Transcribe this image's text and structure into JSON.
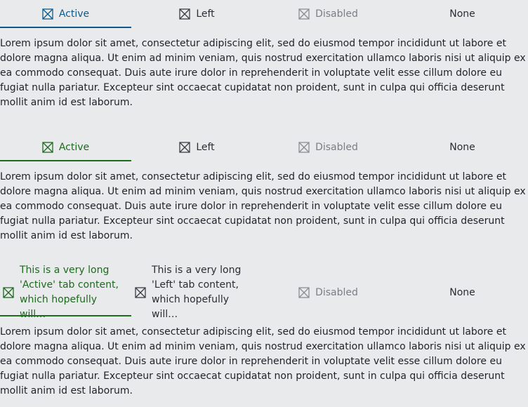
{
  "colors": {
    "background": "#e8eaec",
    "blue_accent": "#0f5a8a",
    "green_accent": "#1e6a1e",
    "disabled": "#7a7e84"
  },
  "icons": {
    "tab_icon": "square-x-icon"
  },
  "groups": [
    {
      "tabs": {
        "active": "Active",
        "left": "Left",
        "disabled": "Disabled",
        "none": "None"
      },
      "body": "Lorem ipsum dolor sit amet, consectetur adipiscing elit, sed do eiusmod tempor incididunt ut labore et dolore magna aliqua. Ut enim ad minim veniam, quis nostrud exercitation ullamco laboris nisi ut aliquip ex ea commodo consequat. Duis aute irure dolor in reprehenderit in voluptate velit esse cillum dolore eu fugiat nulla pariatur. Excepteur sint occaecat cupidatat non proident, sunt in culpa qui officia deserunt mollit anim id est laborum."
    },
    {
      "tabs": {
        "active": "Active",
        "left": "Left",
        "disabled": "Disabled",
        "none": "None"
      },
      "body": "Lorem ipsum dolor sit amet, consectetur adipiscing elit, sed do eiusmod tempor incididunt ut labore et dolore magna aliqua. Ut enim ad minim veniam, quis nostrud exercitation ullamco laboris nisi ut aliquip ex ea commodo consequat. Duis aute irure dolor in reprehenderit in voluptate velit esse cillum dolore eu fugiat nulla pariatur. Excepteur sint occaecat cupidatat non proident, sunt in culpa qui officia deserunt mollit anim id est laborum."
    },
    {
      "tabs": {
        "active_line1": "This is a very long",
        "active_line2": "'Active' tab content,",
        "active_line3": "which hopefully will…",
        "left_line1": "This is a very long",
        "left_line2": "'Left' tab content,",
        "left_line3": "which hopefully will…",
        "disabled": "Disabled",
        "none": "None"
      },
      "body": "Lorem ipsum dolor sit amet, consectetur adipiscing elit, sed do eiusmod tempor incididunt ut labore et dolore magna aliqua. Ut enim ad minim veniam, quis nostrud exercitation ullamco laboris nisi ut aliquip ex ea commodo consequat. Duis aute irure dolor in reprehenderit in voluptate velit esse cillum dolore eu fugiat nulla pariatur. Excepteur sint occaecat cupidatat non proident, sunt in culpa qui officia deserunt mollit anim id est laborum."
    }
  ]
}
